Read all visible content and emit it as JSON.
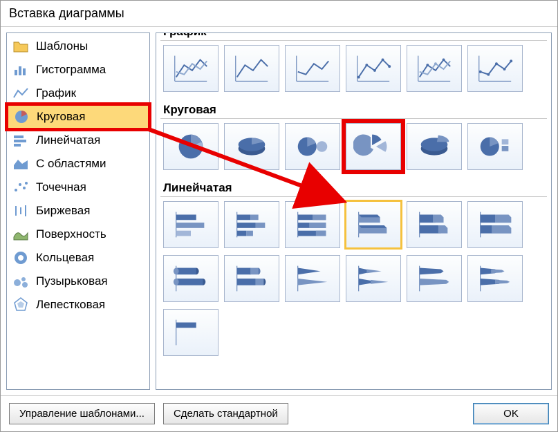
{
  "dialog": {
    "title": "Вставка диаграммы"
  },
  "sidebar": {
    "items": [
      {
        "label": "Шаблоны",
        "icon": "folder"
      },
      {
        "label": "Гистограмма",
        "icon": "column"
      },
      {
        "label": "График",
        "icon": "line"
      },
      {
        "label": "Круговая",
        "icon": "pie",
        "selected": true
      },
      {
        "label": "Линейчатая",
        "icon": "bar"
      },
      {
        "label": "С областями",
        "icon": "area"
      },
      {
        "label": "Точечная",
        "icon": "scatter"
      },
      {
        "label": "Биржевая",
        "icon": "stock"
      },
      {
        "label": "Поверхность",
        "icon": "surface"
      },
      {
        "label": "Кольцевая",
        "icon": "doughnut"
      },
      {
        "label": "Пузырьковая",
        "icon": "bubble"
      },
      {
        "label": "Лепестковая",
        "icon": "radar"
      }
    ]
  },
  "main": {
    "groups": [
      {
        "label": "График",
        "cut": true
      },
      {
        "label": "Круговая"
      },
      {
        "label": "Линейчатая"
      }
    ]
  },
  "buttons": {
    "manage_templates": "Управление шаблонами...",
    "set_default": "Сделать стандартной",
    "ok": "OK"
  },
  "colors": {
    "accent_blue": "#4a6ea9",
    "select_yellow": "#fdd97a",
    "highlight_red": "#e80000"
  }
}
